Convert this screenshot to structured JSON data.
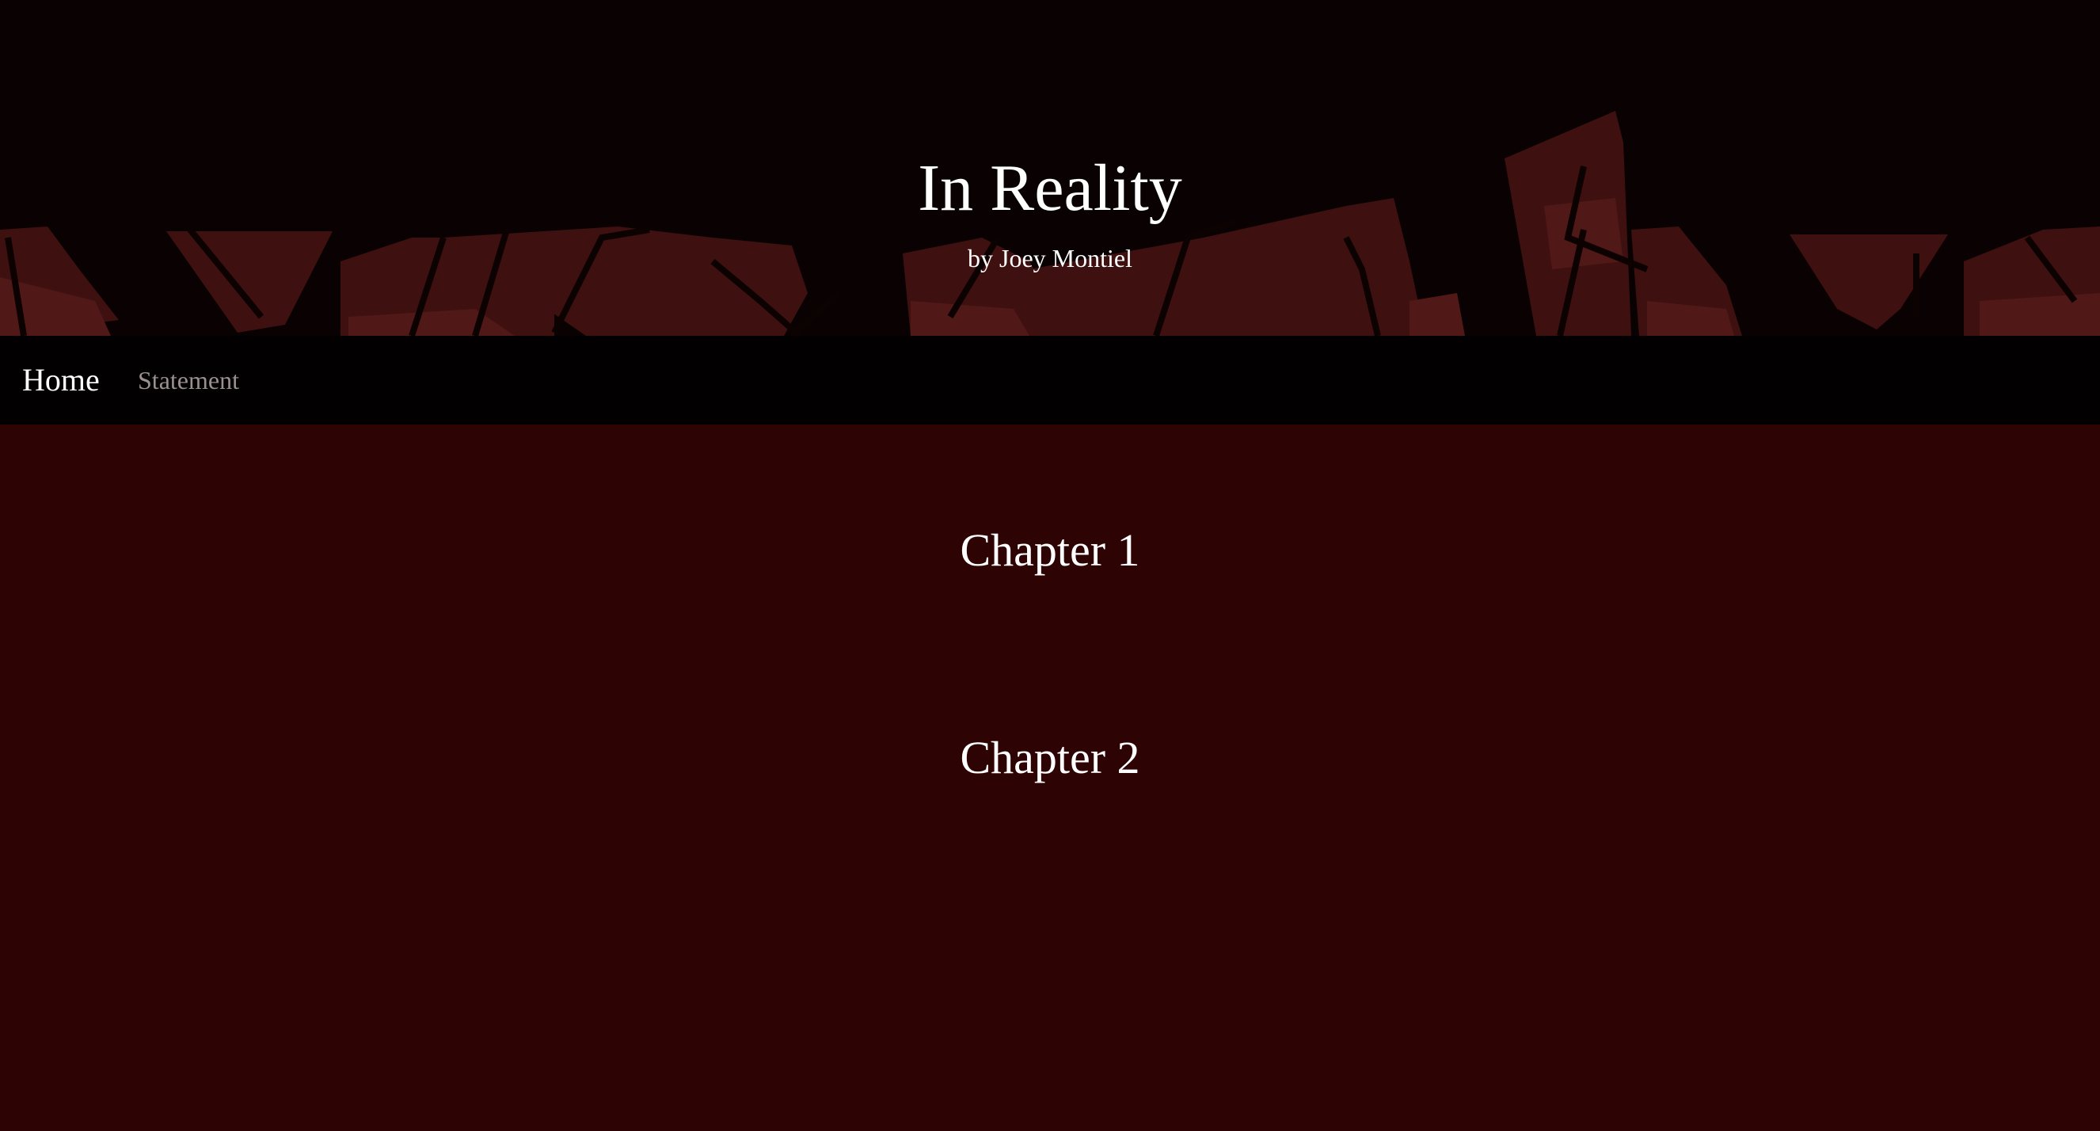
{
  "header": {
    "title": "In Reality",
    "byline": "by Joey Montiel",
    "banner_image": "dark-red-pixel-forest-illustration"
  },
  "nav": {
    "items": [
      {
        "label": "Home",
        "active": true
      },
      {
        "label": "Statement",
        "active": false
      }
    ]
  },
  "chapters": [
    {
      "label": "Chapter 1"
    },
    {
      "label": "Chapter 2"
    }
  ],
  "colors": {
    "header_background": "#0a0202",
    "art_foreground": "#4a1414",
    "art_highlight": "#5a1c1a",
    "nav_background": "#020000",
    "page_background": "#2e0303",
    "text": "#ffffff",
    "nav_inactive_text": "#9a9090"
  }
}
